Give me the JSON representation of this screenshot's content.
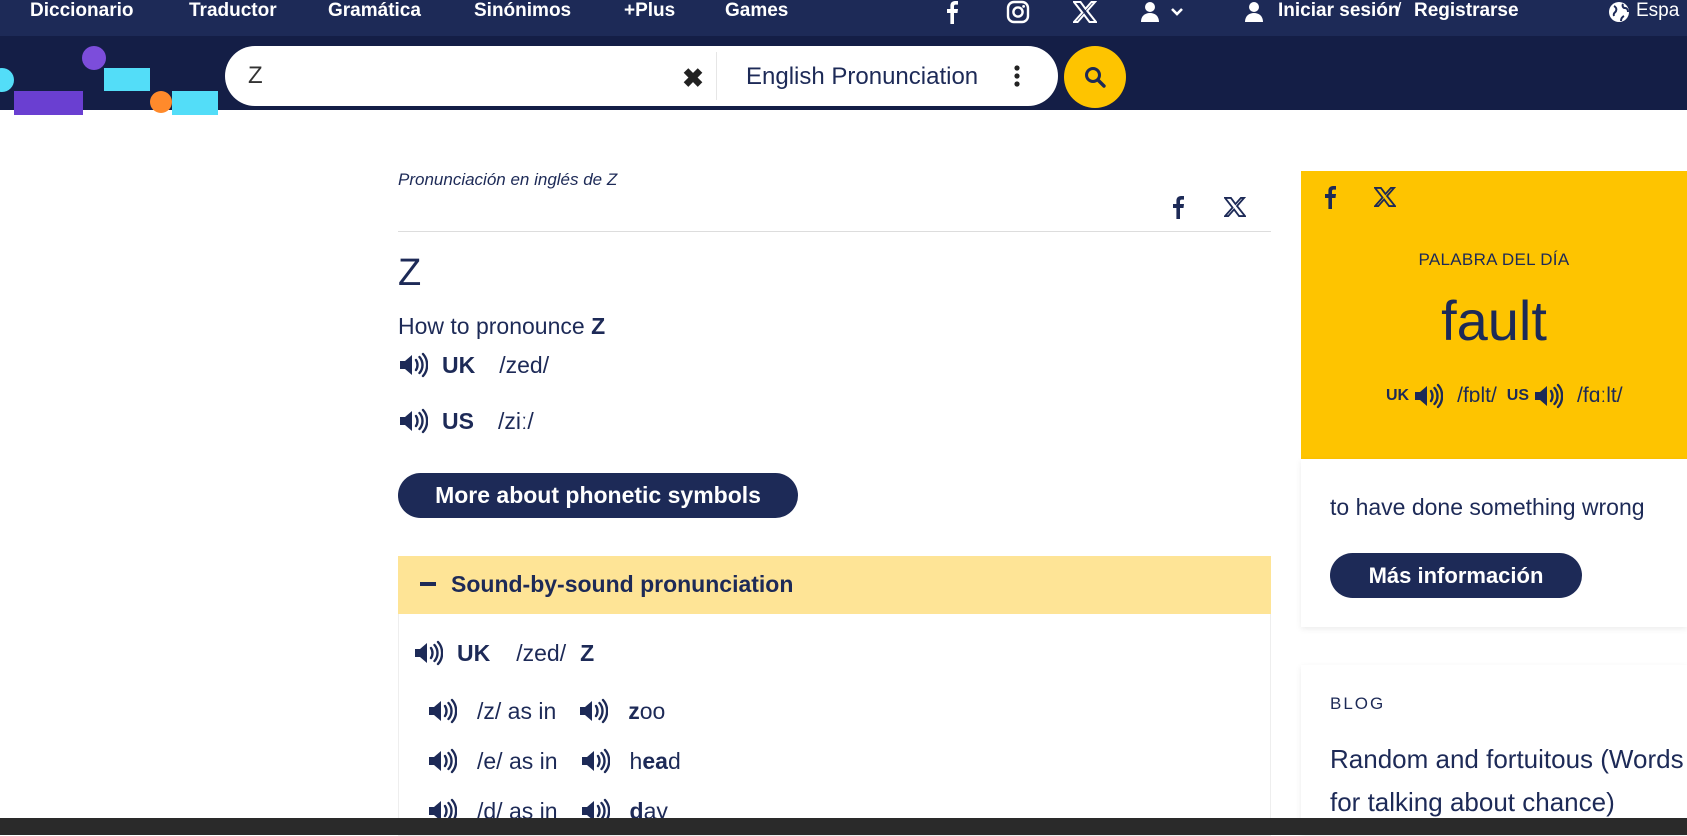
{
  "nav": {
    "items": [
      "Diccionario",
      "Traductor",
      "Gramática",
      "Sinónimos",
      "+Plus",
      "Games"
    ],
    "login": "Iniciar sesión",
    "separator": "/",
    "register": "Registrarse",
    "language": "Espa"
  },
  "search": {
    "value": "Z",
    "dictionary": "English Pronunciation"
  },
  "entry": {
    "page_title": "Pronunciación en inglés de Z",
    "headword": "Z",
    "how_to": "How to pronounce",
    "how_to_word": "Z",
    "uk_label": "UK",
    "uk_ipa": "/zed/",
    "us_label": "US",
    "us_ipa": "/ziː/",
    "phonetic_button": "More about phonetic symbols"
  },
  "sound_by_sound": {
    "title": "Sound-by-sound pronunciation",
    "region": "UK",
    "ipa": "/zed/",
    "word": "Z",
    "rows": [
      {
        "sound": "/z/ as in",
        "word_bold": "z",
        "word_rest": "oo"
      },
      {
        "sound": "/e/ as in",
        "word_pre": "h",
        "word_bold": "ea",
        "word_rest": "d"
      },
      {
        "sound": "/d/ as in",
        "word_bold": "d",
        "word_rest": "ay"
      }
    ]
  },
  "wotd": {
    "label": "PALABRA DEL DÍA",
    "word": "fault",
    "uk_label": "UK",
    "uk_ipa": "/fɒlt/",
    "us_label": "US",
    "us_ipa": "/fɑːlt/",
    "definition": "to have done something wrong",
    "button": "Más información"
  },
  "blog": {
    "label": "BLOG",
    "title": "Random and fortuitous (Words for talking about chance)"
  },
  "colors": {
    "navy": "#1d2a57",
    "yellow": "#fec400",
    "light_yellow": "#fee496"
  }
}
